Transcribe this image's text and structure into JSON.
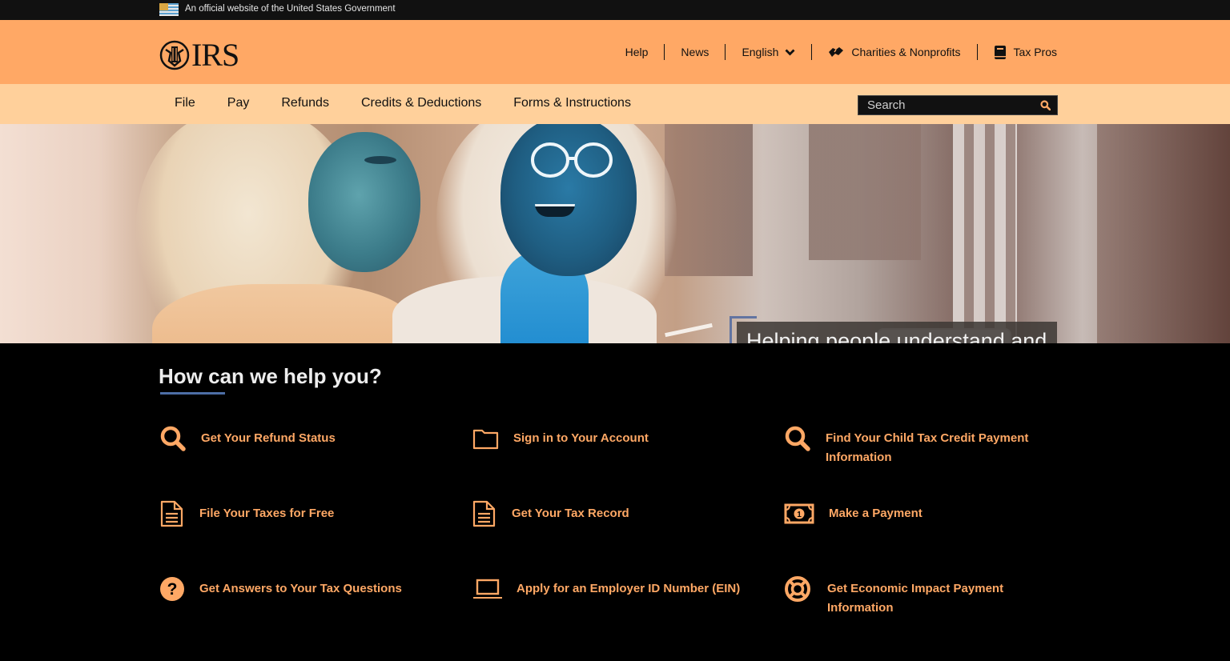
{
  "gov_banner": {
    "text": "An official website of the United States Government"
  },
  "header": {
    "logo_text": "IRS",
    "utility_nav": [
      {
        "label": "Help"
      },
      {
        "label": "News"
      },
      {
        "label": "English"
      },
      {
        "label": "Charities & Nonprofits",
        "icon": "handshake-icon"
      },
      {
        "label": "Tax Pros",
        "icon": "book-icon"
      }
    ]
  },
  "main_nav": {
    "items": [
      {
        "label": "File"
      },
      {
        "label": "Pay"
      },
      {
        "label": "Refunds"
      },
      {
        "label": "Credits & Deductions"
      },
      {
        "label": "Forms & Instructions"
      }
    ],
    "search": {
      "placeholder": "Search",
      "value": ""
    }
  },
  "hero": {
    "tagline": "Helping people understand and meet their tax responsibilities"
  },
  "help": {
    "title": "How can we help you?",
    "items": [
      {
        "label": "Get Your Refund Status",
        "icon": "search-icon"
      },
      {
        "label": "Sign in to Your Account",
        "icon": "folder-icon"
      },
      {
        "label": "Find Your Child Tax Credit Payment Information",
        "icon": "search-icon"
      },
      {
        "label": "File Your Taxes for Free",
        "icon": "document-icon"
      },
      {
        "label": "Get Your Tax Record",
        "icon": "document-icon"
      },
      {
        "label": "Make a Payment",
        "icon": "money-icon"
      },
      {
        "label": "Get Answers to Your Tax Questions",
        "icon": "question-icon"
      },
      {
        "label": "Apply for an Employer ID Number (EIN)",
        "icon": "laptop-icon"
      },
      {
        "label": "Get Economic Impact Payment Information",
        "icon": "lifesaver-icon"
      }
    ]
  },
  "colors": {
    "header_bg": "#ffa865",
    "nav_bg": "#ffd09b",
    "accent": "#ffa865",
    "underline": "#4d6ea6",
    "background": "#000000"
  }
}
